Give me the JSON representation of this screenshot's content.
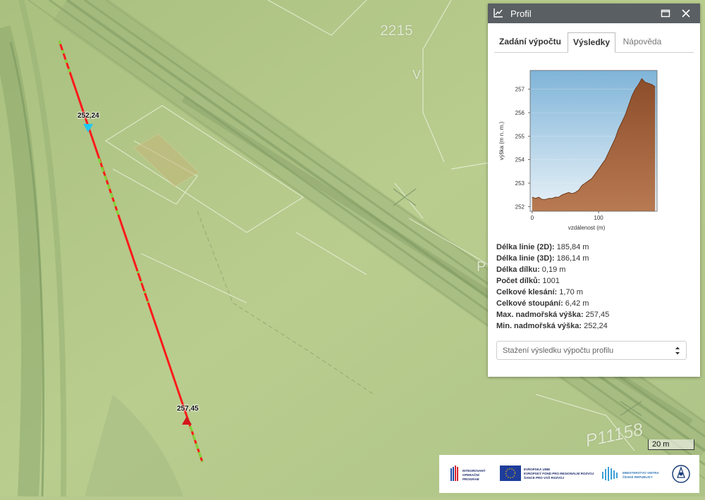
{
  "map": {
    "labels": {
      "parcel_2215": "2215",
      "letter_v": "V",
      "letter_p": "P",
      "parcel_p11158": "P11158"
    },
    "start_point": {
      "elevation_label": "252,24",
      "marker_color": "#1ec8f0"
    },
    "end_point": {
      "elevation_label": "257,45",
      "marker_color": "#d4161b"
    },
    "profile_line_colors": {
      "primary": "#ff1a1a",
      "secondary": "#7cd93a"
    },
    "scale_bar": "20 m"
  },
  "panel": {
    "title": "Profil",
    "tabs": [
      {
        "label": "Zadání výpočtu",
        "active": false
      },
      {
        "label": "Výsledky",
        "active": true
      },
      {
        "label": "Nápověda",
        "active": false
      }
    ],
    "stats": [
      {
        "label": "Délka linie (2D):",
        "value": "185,84 m"
      },
      {
        "label": "Délka linie (3D):",
        "value": "186,14 m"
      },
      {
        "label": "Délka dílku:",
        "value": "0,19 m"
      },
      {
        "label": "Počet dílků:",
        "value": "1001"
      },
      {
        "label": "Celkové klesání:",
        "value": "1,70 m"
      },
      {
        "label": "Celkové stoupání:",
        "value": "6,42 m"
      },
      {
        "label": "Max. nadmořská výška:",
        "value": "257,45"
      },
      {
        "label": "Min. nadmořská výška:",
        "value": "252,24"
      }
    ],
    "download_select": "Stažení výsledku výpočtu profilu"
  },
  "chart_data": {
    "type": "area",
    "xlabel": "vzdálenost (m)",
    "ylabel": "výška (m n. m.)",
    "xlim": [
      -3,
      188
    ],
    "ylim": [
      251.8,
      257.8
    ],
    "x_ticks": [
      0,
      100
    ],
    "x_tick_labels": [
      "0",
      "100"
    ],
    "y_ticks": [
      252,
      253,
      254,
      255,
      256,
      257
    ],
    "y_tick_labels": [
      "252",
      "253",
      "254",
      "255",
      "256",
      "257"
    ],
    "fill_color": "#b87a52",
    "sky_color": "#7fb4d8",
    "x": [
      0,
      5,
      10,
      15,
      20,
      25,
      30,
      35,
      40,
      45,
      50,
      55,
      60,
      65,
      70,
      75,
      80,
      85,
      90,
      95,
      100,
      105,
      110,
      115,
      120,
      125,
      130,
      135,
      140,
      145,
      150,
      155,
      160,
      165,
      170,
      175,
      180,
      185
    ],
    "y": [
      252.4,
      252.35,
      252.4,
      252.3,
      252.3,
      252.35,
      252.35,
      252.4,
      252.4,
      252.5,
      252.55,
      252.6,
      252.55,
      252.6,
      252.7,
      252.9,
      253.0,
      253.1,
      253.2,
      253.4,
      253.6,
      253.8,
      254.0,
      254.3,
      254.6,
      254.9,
      255.3,
      255.6,
      255.9,
      256.3,
      256.7,
      257.0,
      257.2,
      257.45,
      257.3,
      257.25,
      257.2,
      257.1
    ]
  },
  "logos": {
    "iop": [
      "INTEGROVANÝ",
      "OPERAČNÍ",
      "PROGRAM"
    ],
    "eu": [
      "EVROPSKÁ UNIE",
      "EVROPSKÝ FOND PRO REGIONÁLNÍ ROZVOJ",
      "ŠANCE PRO VÁŠ ROZVOJ"
    ],
    "mv": [
      "MINISTERSTVO VNITRA",
      "ČESKÉ REPUBLIKY"
    ]
  }
}
